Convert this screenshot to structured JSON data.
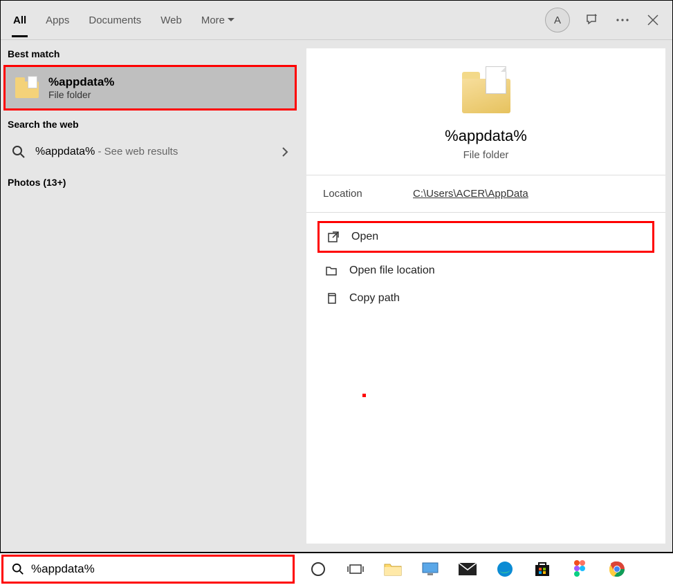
{
  "header": {
    "tabs": {
      "all": "All",
      "apps": "Apps",
      "documents": "Documents",
      "web": "Web",
      "more": "More"
    },
    "avatar_initial": "A"
  },
  "left": {
    "best_match_label": "Best match",
    "best_match": {
      "title": "%appdata%",
      "subtitle": "File folder"
    },
    "web_label": "Search the web",
    "web_result": {
      "term": "%appdata%",
      "desc": " - See web results"
    },
    "photos_label": "Photos (13+)"
  },
  "detail": {
    "title": "%appdata%",
    "subtitle": "File folder",
    "location_label": "Location",
    "location_value": "C:\\Users\\ACER\\AppData",
    "actions": {
      "open": "Open",
      "open_location": "Open file location",
      "copy_path": "Copy path"
    }
  },
  "search": {
    "value": "%appdata%"
  }
}
